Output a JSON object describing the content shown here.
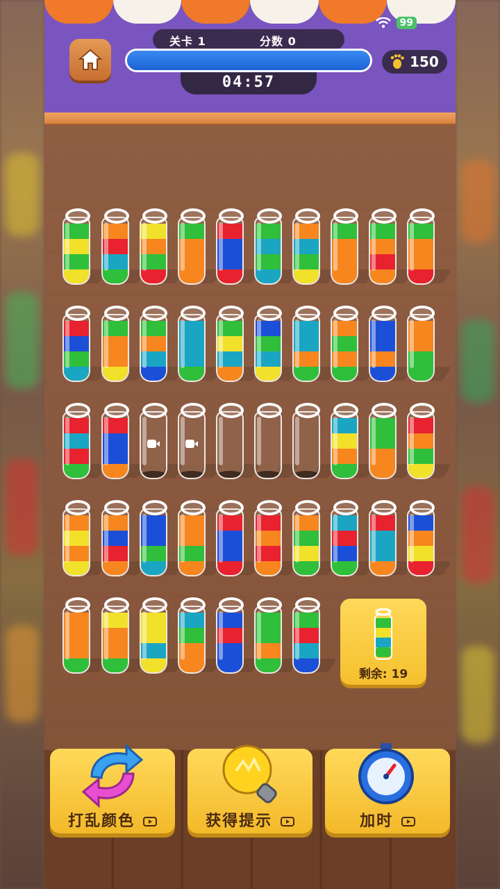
{
  "status_bar": {
    "battery": "99"
  },
  "hud": {
    "level_label": "关卡 1",
    "score_label": "分数 0",
    "progress": 1.0,
    "timer": "04:57",
    "coins": "150"
  },
  "colors": {
    "yellow": "#f2e12a",
    "green": "#2fbf3a",
    "red": "#e8222e",
    "orange": "#f7861f",
    "blue": "#1c4fd8",
    "teal": "#1aa6c3"
  },
  "tubes": [
    {
      "layers": [
        "green",
        "yellow",
        "green",
        "yellow"
      ]
    },
    {
      "layers": [
        "orange",
        "red",
        "teal",
        "green"
      ]
    },
    {
      "layers": [
        "yellow",
        "orange",
        "green",
        "red"
      ]
    },
    {
      "layers": [
        "green",
        "orange",
        "orange",
        "orange"
      ]
    },
    {
      "layers": [
        "red",
        "blue",
        "blue",
        "red"
      ]
    },
    {
      "layers": [
        "green",
        "teal",
        "green",
        "teal"
      ]
    },
    {
      "layers": [
        "orange",
        "teal",
        "green",
        "yellow"
      ]
    },
    {
      "layers": [
        "green",
        "orange",
        "orange",
        "orange"
      ]
    },
    {
      "layers": [
        "green",
        "orange",
        "red",
        "orange"
      ]
    },
    {
      "layers": [
        "green",
        "orange",
        "orange",
        "red"
      ]
    },
    {
      "layers": [
        "red",
        "blue",
        "green",
        "teal"
      ]
    },
    {
      "layers": [
        "green",
        "orange",
        "orange",
        "yellow"
      ]
    },
    {
      "layers": [
        "green",
        "orange",
        "teal",
        "blue"
      ]
    },
    {
      "layers": [
        "teal",
        "teal",
        "teal",
        "green"
      ]
    },
    {
      "layers": [
        "green",
        "yellow",
        "teal",
        "orange"
      ]
    },
    {
      "layers": [
        "blue",
        "green",
        "teal",
        "yellow"
      ]
    },
    {
      "layers": [
        "teal",
        "teal",
        "orange",
        "green"
      ]
    },
    {
      "layers": [
        "orange",
        "green",
        "orange",
        "green"
      ]
    },
    {
      "layers": [
        "blue",
        "blue",
        "orange",
        "blue"
      ]
    },
    {
      "layers": [
        "orange",
        "orange",
        "green",
        "green"
      ]
    },
    {
      "layers": [
        "red",
        "teal",
        "red",
        "green"
      ]
    },
    {
      "layers": [
        "red",
        "blue",
        "blue",
        "orange"
      ]
    },
    {
      "layers": [],
      "video": true
    },
    {
      "layers": [],
      "video": true
    },
    {
      "layers": []
    },
    {
      "layers": []
    },
    {
      "layers": []
    },
    {
      "layers": [
        "teal",
        "yellow",
        "orange",
        "green"
      ]
    },
    {
      "layers": [
        "green",
        "green",
        "orange",
        "orange"
      ]
    },
    {
      "layers": [
        "red",
        "orange",
        "green",
        "yellow"
      ]
    },
    {
      "layers": [
        "orange",
        "yellow",
        "orange",
        "yellow"
      ]
    },
    {
      "layers": [
        "orange",
        "blue",
        "red",
        "orange"
      ]
    },
    {
      "layers": [
        "blue",
        "blue",
        "green",
        "teal"
      ]
    },
    {
      "layers": [
        "orange",
        "orange",
        "green",
        "orange"
      ]
    },
    {
      "layers": [
        "red",
        "blue",
        "blue",
        "red"
      ]
    },
    {
      "layers": [
        "red",
        "orange",
        "red",
        "orange"
      ]
    },
    {
      "layers": [
        "orange",
        "green",
        "yellow",
        "green"
      ]
    },
    {
      "layers": [
        "teal",
        "red",
        "blue",
        "green"
      ]
    },
    {
      "layers": [
        "red",
        "teal",
        "teal",
        "orange"
      ]
    },
    {
      "layers": [
        "blue",
        "orange",
        "yellow",
        "red"
      ]
    },
    {
      "layers": [
        "orange",
        "orange",
        "orange",
        "green"
      ]
    },
    {
      "layers": [
        "yellow",
        "orange",
        "orange",
        "green"
      ]
    },
    {
      "layers": [
        "yellow",
        "yellow",
        "teal",
        "yellow"
      ]
    },
    {
      "layers": [
        "teal",
        "green",
        "orange",
        "orange"
      ]
    },
    {
      "layers": [
        "blue",
        "red",
        "blue",
        "blue"
      ]
    },
    {
      "layers": [
        "green",
        "green",
        "orange",
        "green"
      ]
    },
    {
      "layers": [
        "green",
        "red",
        "teal",
        "blue"
      ]
    }
  ],
  "remaining": {
    "label": "剩余: 19",
    "preview_layers": [
      "green",
      "yellow",
      "blue",
      "green"
    ]
  },
  "actions": [
    {
      "label": "打乱颜色",
      "icon": "shuffle-arrows-icon"
    },
    {
      "label": "获得提示",
      "icon": "lightbulb-icon"
    },
    {
      "label": "加时",
      "icon": "stopwatch-icon"
    }
  ]
}
